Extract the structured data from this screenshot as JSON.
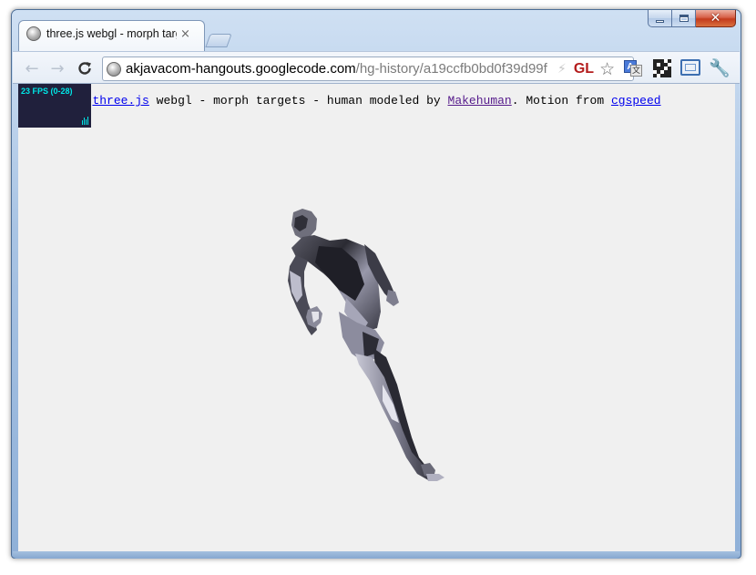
{
  "window": {
    "colors": {
      "frame": "#a9c4e4",
      "close_button": "#c43b1d"
    },
    "caption_buttons": {
      "minimize_icon": "minimize-icon",
      "maximize_icon": "maximize-icon",
      "close_icon": "close-icon",
      "close_glyph": "✕"
    }
  },
  "tabs": [
    {
      "title": "three.js webgl - morph targ",
      "icon": "globe-icon",
      "close_glyph": "×"
    }
  ],
  "toolbar": {
    "back_glyph": "←",
    "forward_glyph": "→",
    "reload_glyph": "C",
    "omnibox": {
      "domain": "akjavacom-hangouts.googlecode.com",
      "path": "/hg-history/a19ccfb0bd0f39d99f",
      "bolt_glyph": "⚡",
      "gl_badge": "GL",
      "star_glyph": "☆"
    },
    "extensions": [
      "translate-icon",
      "qr-code-icon",
      "fullscreen-icon"
    ],
    "wrench_glyph": "🔧"
  },
  "page": {
    "background": "#f0f0f0",
    "stats": {
      "fps_text": "23 FPS (0-28)",
      "color": "#00e7e7"
    },
    "info": {
      "link_threejs": "three.js",
      "text_1": " webgl - morph targets - human modeled by ",
      "link_makehuman": "Makehuman",
      "text_2": ". Motion from ",
      "link_cgspeed": "cgspeed"
    }
  }
}
